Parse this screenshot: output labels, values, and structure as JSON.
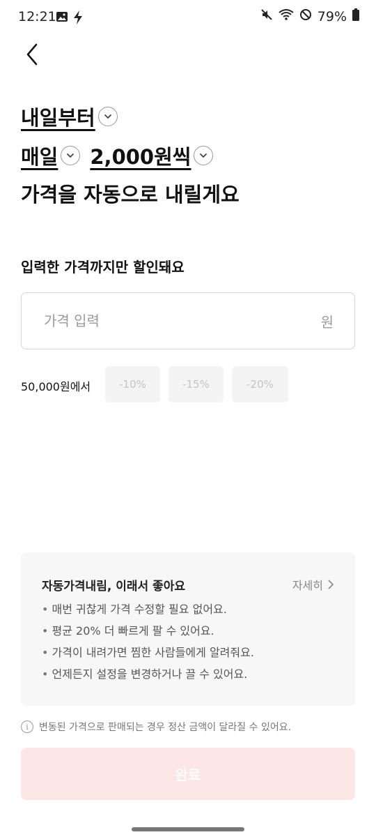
{
  "status_bar": {
    "time": "12:21",
    "battery": "79%"
  },
  "headline": {
    "start": "내일부터",
    "frequency": "매일",
    "amount": "2,000원씩",
    "rest": "가격을 자동으로 내릴게요"
  },
  "form": {
    "subtitle": "입력한 가격까지만 할인돼요",
    "price_placeholder": "가격 입력",
    "price_value": "",
    "unit": "원"
  },
  "discount": {
    "base_label": "50,000원에서",
    "options": [
      "-10%",
      "-15%",
      "-20%"
    ]
  },
  "info": {
    "title": "자동가격내림, 이래서 좋아요",
    "link": "자세히",
    "bullets": [
      "매번 귀찮게 가격 수정할 필요 없어요.",
      "평균 20% 더 빠르게 팔 수 있어요.",
      "가격이 내려가면 찜한 사람들에게 알려줘요.",
      "언제든지 설정을 변경하거나 끌 수 있어요."
    ]
  },
  "notice": "변동된 가격으로 판매되는 경우 정산 금액이 달라질 수 있어요.",
  "done_button": "완료",
  "colors": {
    "button_bg": "#fde6e6",
    "text": "#111111",
    "muted": "#9a9a9a"
  }
}
